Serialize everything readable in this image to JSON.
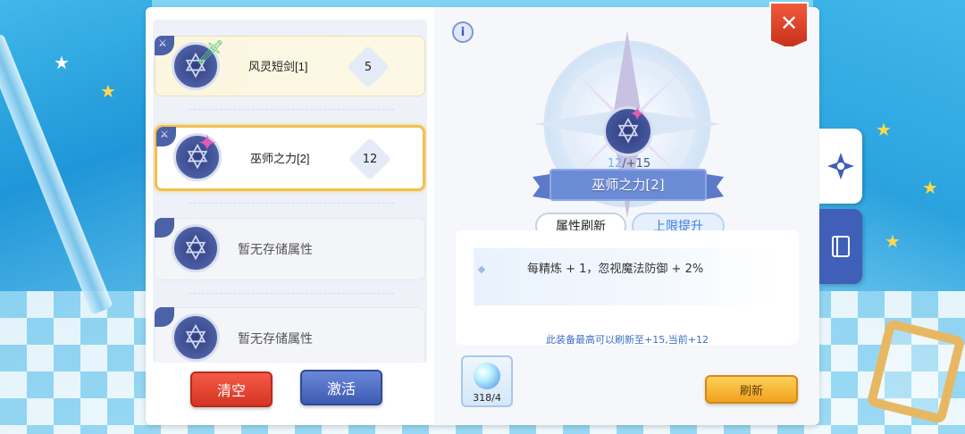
{
  "slots": [
    {
      "name": "风灵短剑[1]",
      "level": "5",
      "state": "equipped",
      "item_icon": "wind-dagger-icon"
    },
    {
      "name": "巫师之力[2]",
      "level": "12",
      "state": "selected",
      "item_icon": "wizard-staff-icon"
    },
    {
      "empty_text": "暂无存储属性",
      "state": "empty"
    },
    {
      "empty_text": "暂无存储属性",
      "state": "empty"
    }
  ],
  "buttons": {
    "clear": "清空",
    "activate": "激活",
    "refresh": "刷新"
  },
  "detail": {
    "refine_current": "12",
    "refine_max": "/+15",
    "item_name": "巫师之力[2]",
    "tabs": {
      "refresh": "属性刷新",
      "limit": "上限提升"
    },
    "attribute_text": "每精炼 + 1，忽视魔法防御 + 2%",
    "note": "此装备最高可以刷新至+15,当前+12"
  },
  "material": {
    "count": "318/4",
    "icon": "crystal-icon"
  },
  "colors": {
    "close": "#e2452b",
    "activate": "#4a67c2",
    "clear": "#e0402f",
    "refresh": "#f5b02c",
    "selected_border": "#f3c04c",
    "tab_accent": "#3d7be0"
  }
}
